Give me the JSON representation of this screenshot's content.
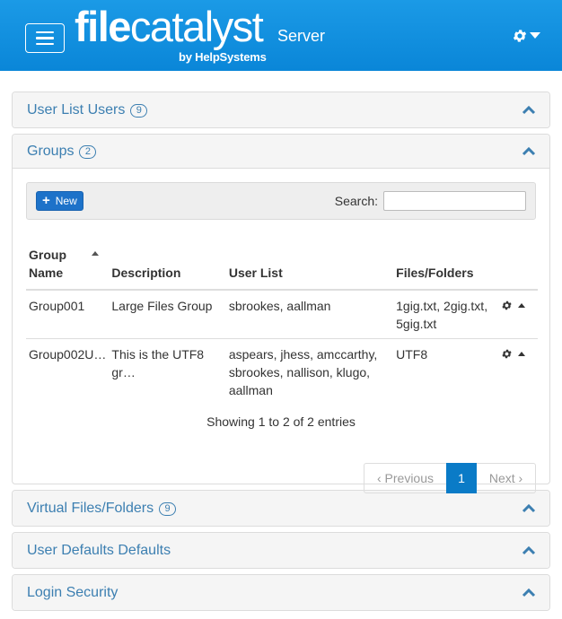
{
  "header": {
    "logo_part1": "file",
    "logo_part2": "catalyst",
    "byline": "by HelpSystems",
    "server_label": "Server",
    "menu_icon": "hamburger-icon",
    "settings_icon": "gear-icon"
  },
  "panels": {
    "user_list_users": {
      "title": "User List Users",
      "count": "9"
    },
    "groups": {
      "title": "Groups",
      "count": "2"
    },
    "virtual_files": {
      "title": "Virtual Files/Folders",
      "count": "9"
    },
    "user_defaults": {
      "title": "User Defaults Defaults"
    },
    "login_security": {
      "title": "Login Security"
    }
  },
  "groups_table": {
    "new_label": "New",
    "search_label": "Search:",
    "search_value": "",
    "columns": [
      "Group\nName",
      "Description",
      "User List",
      "Files/Folders"
    ],
    "col_group_line1": "Group",
    "col_group_line2": "Name",
    "rows": [
      {
        "group": "Group001",
        "description": "Large Files Group",
        "users": "sbrookes, aallman",
        "files": "1gig.txt, 2gig.txt, 5gig.txt"
      },
      {
        "group": "Group002U…",
        "description": "This is the UTF8 gr…",
        "users": "aspears, jhess, amccarthy, sbrookes, nallison, klugo, aallman",
        "files": "UTF8"
      }
    ],
    "info": "Showing 1 to 2 of 2 entries",
    "pagination": {
      "previous": "‹  Previous",
      "current": "1",
      "next": "Next  ›"
    }
  },
  "colors": {
    "header_blue": "#0a86d8",
    "title_blue": "#3c7fb1",
    "button_blue": "#1d72c9"
  }
}
